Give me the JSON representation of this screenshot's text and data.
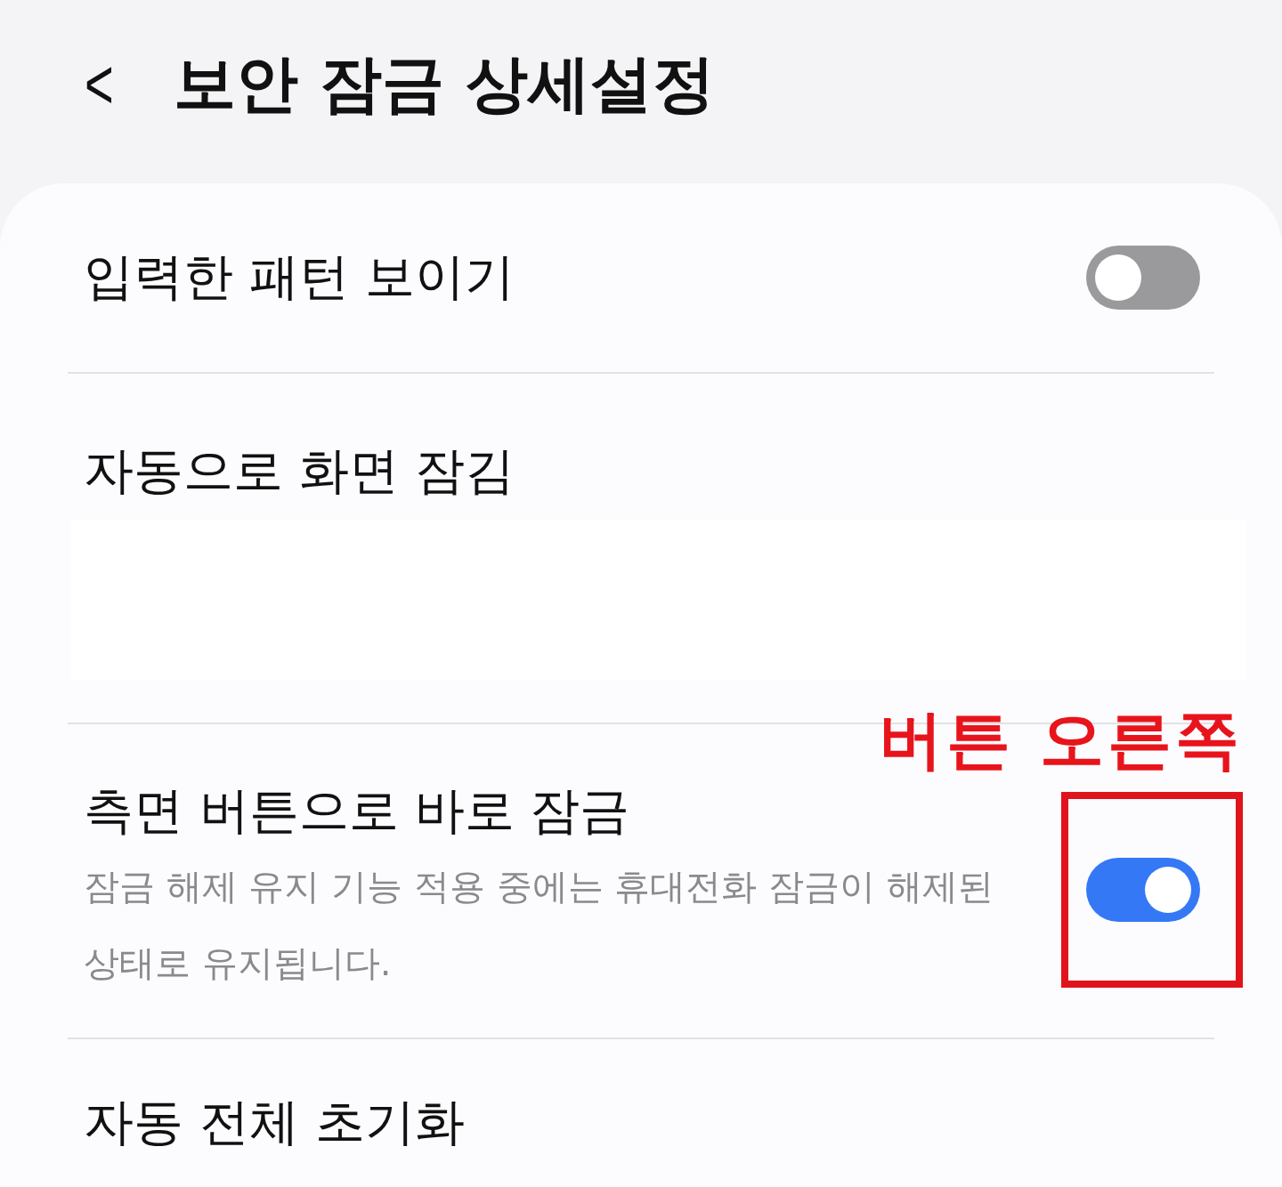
{
  "header": {
    "back": "<",
    "title": "보안 잠금 상세설정"
  },
  "rows": [
    {
      "kind": "toggle",
      "label": "입력한 패턴 보이기",
      "on": false
    },
    {
      "kind": "hidden",
      "label": "자동으로 화면 잠김"
    },
    {
      "kind": "toggle",
      "label": "측면 버튼으로 바로 잠금",
      "description": "잠금 해제 유지 기능 적용 중에는 휴대전화 잠금이 해제된 상태로 유지됩니다.",
      "on": true,
      "annotation": "버튼 오른쪽"
    },
    {
      "kind": "plain",
      "label": "자동 전체 초기화"
    }
  ]
}
